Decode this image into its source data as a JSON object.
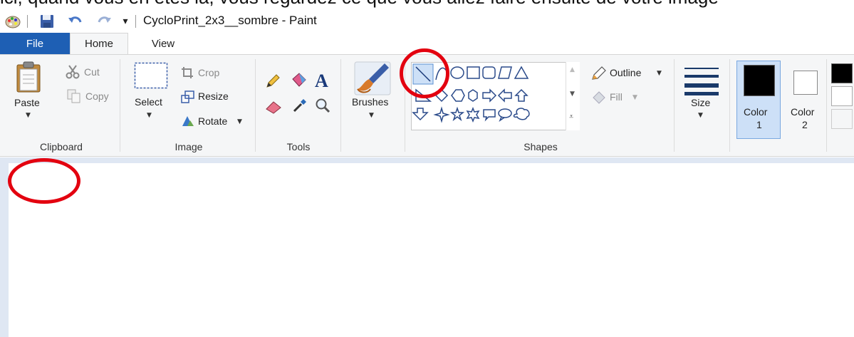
{
  "window": {
    "title": "CycloPrint_2x3__sombre - Paint",
    "cropped_top_text": "ici, quand vous en êtes là, vous regardez ce que vous allez faire ensuite de votre image"
  },
  "quick_access": {
    "customize_glyph": "▾"
  },
  "tabs": {
    "file": "File",
    "home": "Home",
    "view": "View"
  },
  "clipboard": {
    "paste": "Paste",
    "cut": "Cut",
    "copy": "Copy",
    "label": "Clipboard"
  },
  "image": {
    "select": "Select",
    "crop": "Crop",
    "resize": "Resize",
    "rotate": "Rotate",
    "label": "Image"
  },
  "tools": {
    "label": "Tools"
  },
  "brushes": {
    "label": "Brushes"
  },
  "shapes": {
    "outline": "Outline",
    "fill": "Fill",
    "label": "Shapes"
  },
  "size": {
    "label": "Size"
  },
  "colors": {
    "color1_line1": "Color",
    "color1_line2": "1",
    "color2_line1": "Color",
    "color2_line2": "2"
  },
  "accent": {
    "file_tab": "#1e5fb4",
    "annotation_red": "#e3000f",
    "selected": "#cde0f7"
  }
}
